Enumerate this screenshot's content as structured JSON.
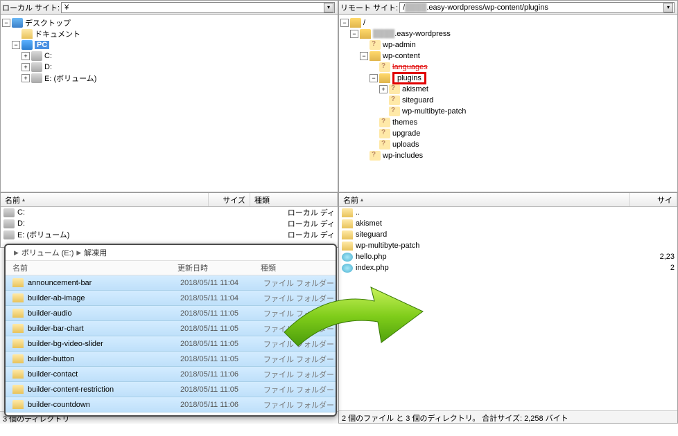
{
  "local": {
    "header_label": "ローカル サイト:",
    "path": "¥",
    "tree": {
      "desktop": "デスクトップ",
      "documents": "ドキュメント",
      "pc": "PC",
      "c": "C:",
      "d": "D:",
      "e": "E: (ボリューム)"
    }
  },
  "remote": {
    "header_label": "リモート サイト:",
    "path_prefix": "/",
    "path_blur": "████",
    "path_suffix": ".easy-wordpress/wp-content/plugins",
    "tree": {
      "root": "/",
      "site_blur": "████",
      "site_suffix": ".easy-wordpress",
      "wp_admin": "wp-admin",
      "wp_content": "wp-content",
      "languages": "languages",
      "plugins": "plugins",
      "akismet": "akismet",
      "siteguard": "siteguard",
      "wp_multibyte": "wp-multibyte-patch",
      "themes": "themes",
      "upgrade": "upgrade",
      "uploads": "uploads",
      "wp_includes": "wp-includes"
    }
  },
  "local_list": {
    "col_name": "名前",
    "col_size": "サイズ",
    "col_type": "種類",
    "rows": {
      "c": {
        "name": "C:",
        "type": "ローカル ディ"
      },
      "d": {
        "name": "D:",
        "type": "ローカル ディ"
      },
      "e": {
        "name": "E: (ボリューム)",
        "type": "ローカル ディ"
      }
    },
    "status": "3 個のディレクトリ"
  },
  "remote_list": {
    "col_name": "名前",
    "col_size": "サイ",
    "rows": {
      "up": "..",
      "akismet": "akismet",
      "siteguard": "siteguard",
      "wp_multibyte": "wp-multibyte-patch",
      "hello": {
        "name": "hello.php",
        "size": "2,23"
      },
      "index": {
        "name": "index.php",
        "size": "2"
      }
    },
    "status": "2 個のファイル と 3 個のディレクトリ。 合計サイズ: 2,258 バイト"
  },
  "popup": {
    "crumb1": "ボリューム (E:)",
    "crumb2": "解凍用",
    "col_name": "名前",
    "col_date": "更新日時",
    "col_type": "種類",
    "rows": [
      {
        "name": "announcement-bar",
        "date": "2018/05/11 11:04",
        "type": "ファイル フォルダー"
      },
      {
        "name": "builder-ab-image",
        "date": "2018/05/11 11:04",
        "type": "ファイル フォルダー"
      },
      {
        "name": "builder-audio",
        "date": "2018/05/11 11:05",
        "type": "ファイル フォルダー"
      },
      {
        "name": "builder-bar-chart",
        "date": "2018/05/11 11:05",
        "type": "ファイル フォルダー"
      },
      {
        "name": "builder-bg-video-slider",
        "date": "2018/05/11 11:05",
        "type": "ファイル フォルダー"
      },
      {
        "name": "builder-button",
        "date": "2018/05/11 11:05",
        "type": "ファイル フォルダー"
      },
      {
        "name": "builder-contact",
        "date": "2018/05/11 11:06",
        "type": "ファイル フォルダー"
      },
      {
        "name": "builder-content-restriction",
        "date": "2018/05/11 11:05",
        "type": "ファイル フォルダー"
      },
      {
        "name": "builder-countdown",
        "date": "2018/05/11 11:06",
        "type": "ファイル フォルダー"
      }
    ]
  }
}
